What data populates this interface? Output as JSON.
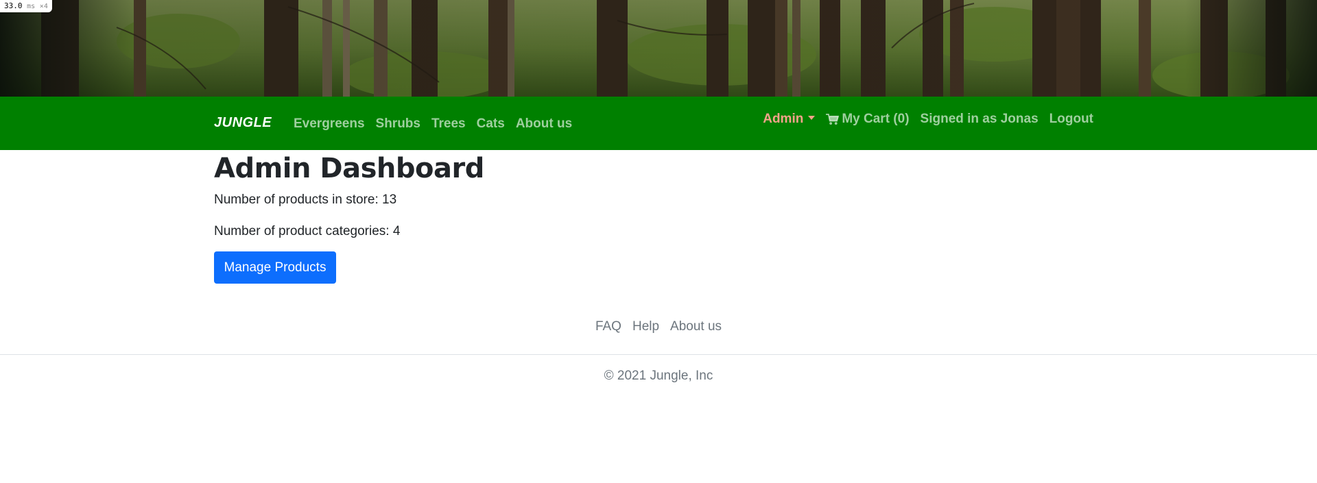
{
  "perf": {
    "value": "33.0",
    "unit": "ms",
    "multiplier": "×4"
  },
  "hero": {
    "image": "forest-banner"
  },
  "navbar": {
    "brand": "JUNGLE",
    "links": [
      "Evergreens",
      "Shrubs",
      "Trees",
      "Cats",
      "About us"
    ],
    "admin_label": "Admin",
    "cart_label": "My Cart (0)",
    "signed_in_label": "Signed in as Jonas",
    "logout_label": "Logout",
    "colors": {
      "background": "#008000",
      "admin": "#f4a38a"
    }
  },
  "main": {
    "title": "Admin Dashboard",
    "products_count_text": "Number of products in store: 13",
    "categories_count_text": "Number of product categories: 4",
    "manage_button_label": "Manage Products",
    "colors": {
      "button": "#0d6efd"
    }
  },
  "footer": {
    "links": [
      "FAQ",
      "Help",
      "About us"
    ],
    "copyright": "© 2021 Jungle, Inc"
  }
}
